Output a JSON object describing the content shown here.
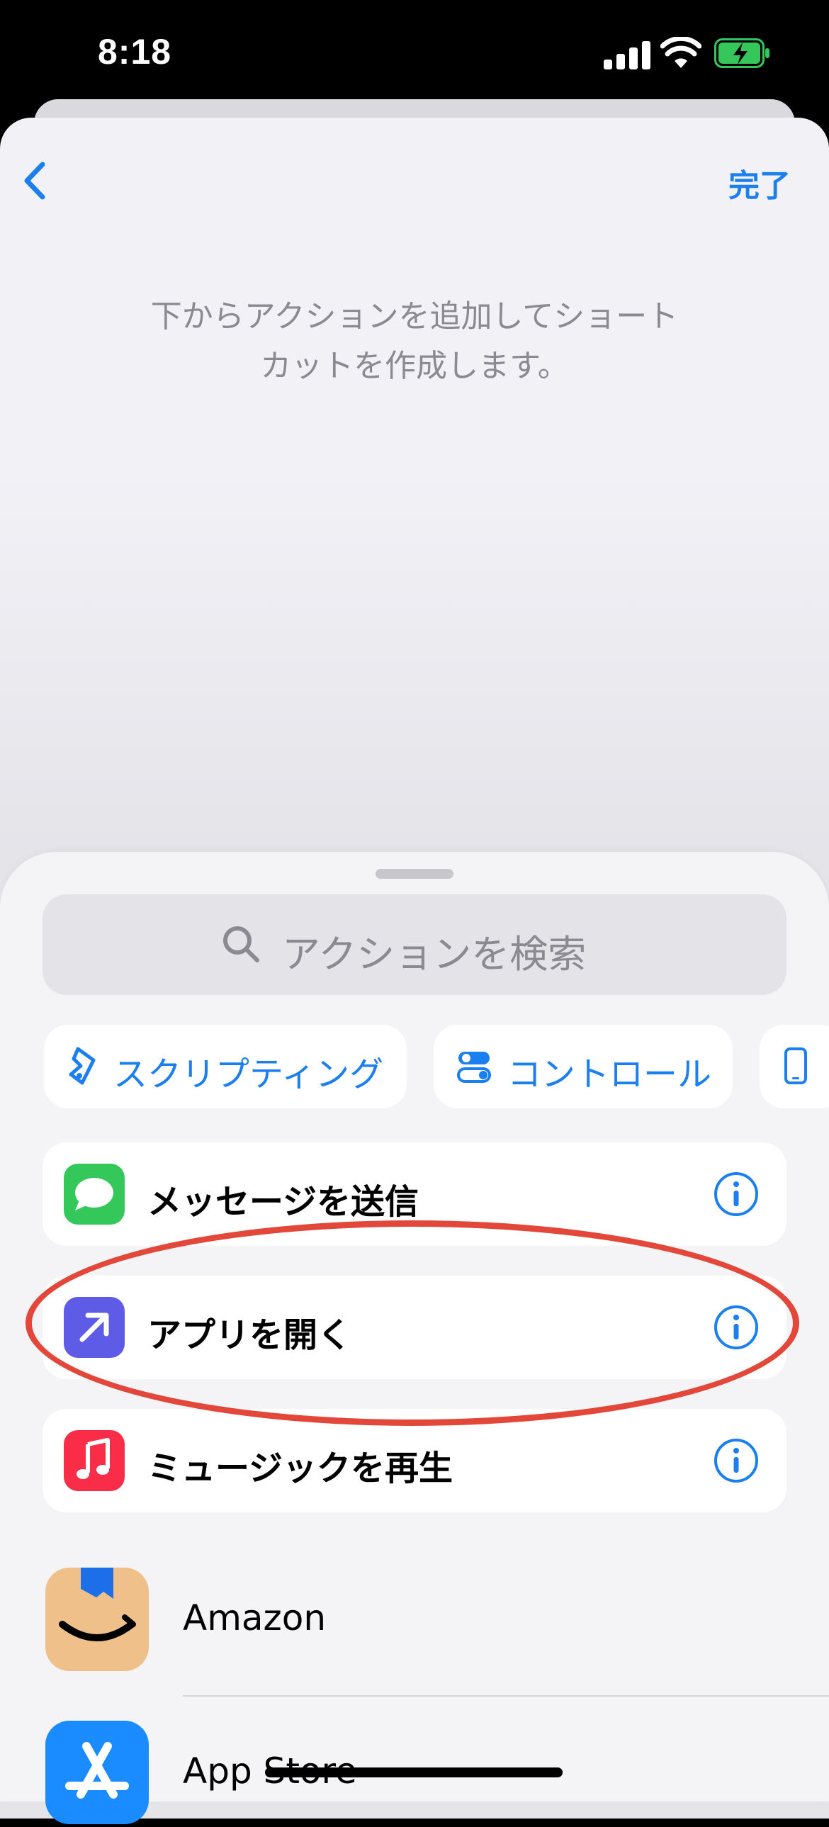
{
  "status_bar": {
    "time": "8:18",
    "battery_state": "charging"
  },
  "nav": {
    "done_label": "完了"
  },
  "hint": "下からアクションを追加してショート\nカットを作成します。",
  "search": {
    "placeholder": "アクションを検索"
  },
  "categories": [
    {
      "label": "スクリプティング",
      "icon": "scripting-icon"
    },
    {
      "label": "コントロール",
      "icon": "toggle-icon"
    },
    {
      "label": "",
      "icon": "device-icon"
    }
  ],
  "actions": [
    {
      "label": "メッセージを送信",
      "icon": "messages-icon"
    },
    {
      "label": "アプリを開く",
      "icon": "open-app-icon"
    },
    {
      "label": "ミュージックを再生",
      "icon": "music-icon"
    }
  ],
  "apps": [
    {
      "label": "Amazon",
      "icon": "amazon-icon"
    },
    {
      "label": "App Store",
      "icon": "app-store-icon"
    }
  ],
  "colors": {
    "accent": "#1c7ff0",
    "highlight": "#e2473a",
    "messages_green": "#34c759",
    "open_app_purple": "#5e5ce6",
    "music_red": "#fa2d48",
    "amazon_bg": "#f0c08a",
    "appstore_blue": "#1a8cff"
  }
}
